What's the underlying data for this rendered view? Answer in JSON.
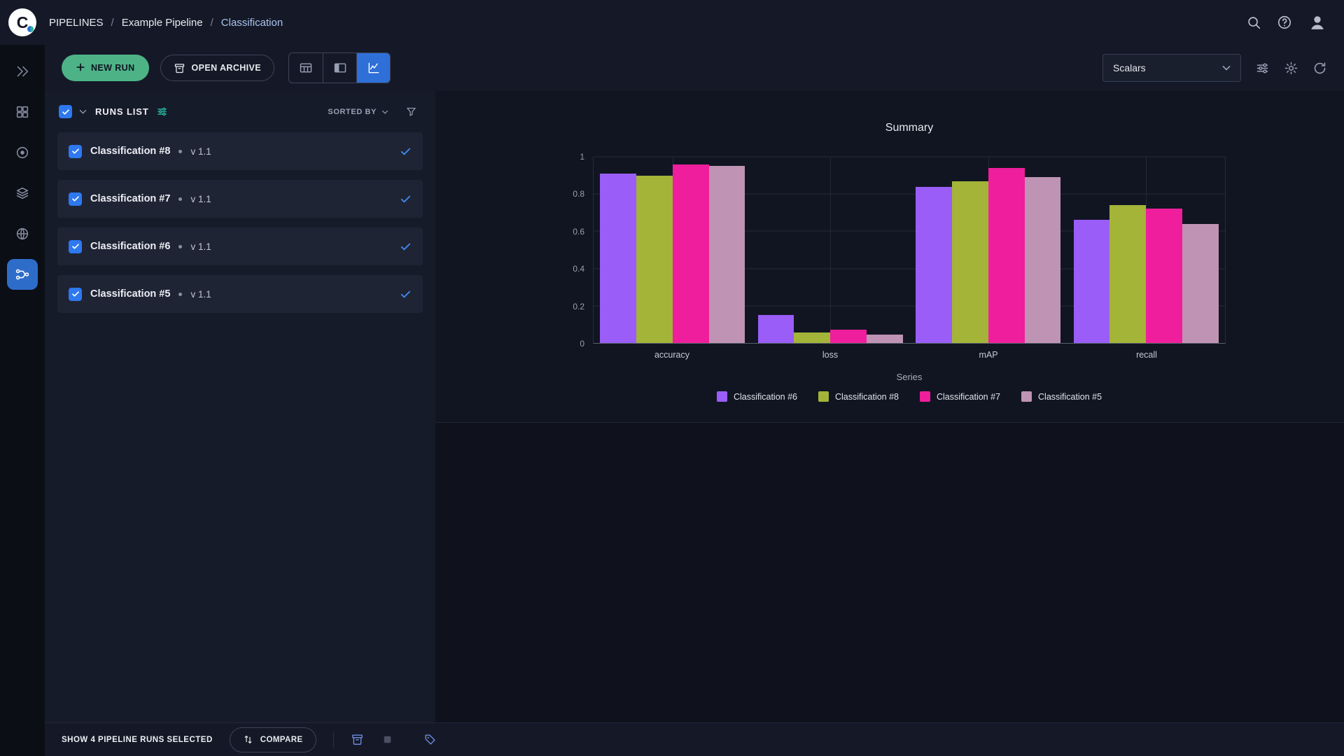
{
  "header": {
    "logo_letter": "C",
    "breadcrumb": [
      "PIPELINES",
      "Example Pipeline",
      "Classification"
    ],
    "icons": [
      "search-icon",
      "help-icon",
      "user-avatar-icon"
    ]
  },
  "sidebar": {
    "items": [
      {
        "name": "projects",
        "active": false
      },
      {
        "name": "reports",
        "active": false
      },
      {
        "name": "tasks",
        "active": false
      },
      {
        "name": "datasets",
        "active": false
      },
      {
        "name": "models",
        "active": false
      },
      {
        "name": "pipelines",
        "active": true
      }
    ]
  },
  "toolbar": {
    "new_run_label": "NEW RUN",
    "open_archive_label": "OPEN ARCHIVE",
    "view_toggles": [
      "table-view-icon",
      "split-view-icon",
      "scalars-view-icon"
    ],
    "active_view": "scalars-view-icon",
    "metric_select_value": "Scalars",
    "right_icons": [
      "tune-icon",
      "settings-gear-icon",
      "auto-refresh-icon"
    ]
  },
  "runs_panel": {
    "title": "RUNS LIST",
    "sorted_by_label": "SORTED BY",
    "runs": [
      {
        "name": "Classification #8",
        "version": "v 1.1",
        "selected": true
      },
      {
        "name": "Classification #7",
        "version": "v 1.1",
        "selected": true
      },
      {
        "name": "Classification #6",
        "version": "v 1.1",
        "selected": true
      },
      {
        "name": "Classification #5",
        "version": "v 1.1",
        "selected": true
      }
    ]
  },
  "chart_data": {
    "type": "bar",
    "title": "Summary",
    "categories": [
      "accuracy",
      "loss",
      "mAP",
      "recall"
    ],
    "series": [
      {
        "name": "Classification #6",
        "color": "#9a5df7",
        "values": [
          0.91,
          0.15,
          0.84,
          0.66
        ]
      },
      {
        "name": "Classification #8",
        "color": "#a3b438",
        "values": [
          0.9,
          0.055,
          0.87,
          0.74
        ]
      },
      {
        "name": "Classification #7",
        "color": "#ef1e9c",
        "values": [
          0.96,
          0.07,
          0.94,
          0.72
        ]
      },
      {
        "name": "Classification #5",
        "color": "#bf93b3",
        "values": [
          0.95,
          0.046,
          0.89,
          0.64
        ]
      }
    ],
    "xlabel": "Series",
    "ylabel": "",
    "ylim": [
      0,
      1
    ],
    "yticks": [
      0,
      0.2,
      0.4,
      0.6,
      0.8,
      1
    ],
    "grid": true,
    "legend_position": "bottom"
  },
  "footer": {
    "selection_text": "SHOW 4 PIPELINE RUNS SELECTED",
    "compare_label": "COMPARE",
    "icons": [
      "archive-icon",
      "stop-icon",
      "tag-icon"
    ]
  },
  "colors": {
    "accent_blue": "#2e6fd8",
    "checkbox_blue": "#2e78f0",
    "new_run_green": "#4db387",
    "selected_check_blue": "#3f8cf5"
  }
}
